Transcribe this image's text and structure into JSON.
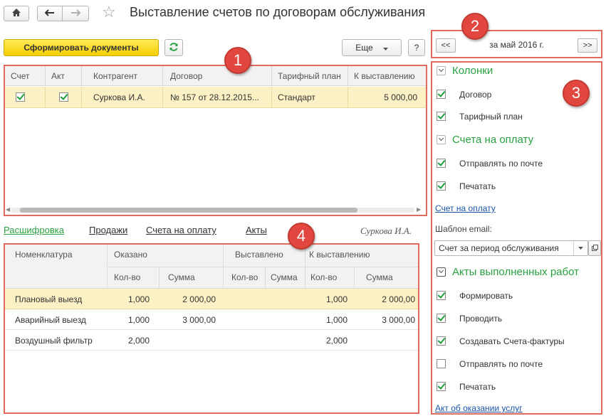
{
  "window": {
    "title": "Выставление счетов по договорам обслуживания"
  },
  "toolbar": {
    "generate_label": "Сформировать документы",
    "more_label": "Еще",
    "help_label": "?"
  },
  "period": {
    "prev_label": "<<",
    "label": "за май 2016 г.",
    "next_label": ">>"
  },
  "contracts_table": {
    "columns": [
      "Счет",
      "Акт",
      "Контрагент",
      "Договор",
      "Тарифный план",
      "К выставлению"
    ],
    "rows": [
      {
        "invoice": true,
        "act": true,
        "counterparty": "Суркова И.А.",
        "contract": "№ 157 от 28.12.2015...",
        "tariff": "Стандарт",
        "to_bill": "5 000,00"
      }
    ]
  },
  "tabs": {
    "items": [
      "Расшифровка",
      "Продажи",
      "Счета на оплату",
      "Акты"
    ],
    "active": "Расшифровка",
    "counterparty_note": "Суркова И.А."
  },
  "details_table": {
    "nomenclature_header": "Номенклатура",
    "group_headers": [
      "Оказано",
      "Выставлено",
      "К выставлению"
    ],
    "sub_headers": [
      "Кол-во",
      "Сумма",
      "Кол-во",
      "Сумма",
      "Кол-во",
      "Сумма"
    ],
    "rows": [
      {
        "name": "Плановый выезд",
        "done_qty": "1,000",
        "done_sum": "2 000,00",
        "billed_qty": "",
        "billed_sum": "",
        "to_bill_qty": "1,000",
        "to_bill_sum": "2 000,00"
      },
      {
        "name": "Аварийный выезд",
        "done_qty": "1,000",
        "done_sum": "3 000,00",
        "billed_qty": "",
        "billed_sum": "",
        "to_bill_qty": "1,000",
        "to_bill_sum": "3 000,00"
      },
      {
        "name": "Воздушный фильтр",
        "done_qty": "2,000",
        "done_sum": "",
        "billed_qty": "",
        "billed_sum": "",
        "to_bill_qty": "2,000",
        "to_bill_sum": ""
      }
    ]
  },
  "settings_panel": {
    "columns_title": "Колонки",
    "columns_options": [
      {
        "label": "Договор",
        "checked": true
      },
      {
        "label": "Тарифный план",
        "checked": true
      }
    ],
    "invoices_title": "Счета на оплату",
    "invoices_options": [
      {
        "label": "Отправлять по почте",
        "checked": true
      },
      {
        "label": "Печатать",
        "checked": true
      }
    ],
    "invoice_link": "Счет на оплату",
    "email_template_label": "Шаблон email:",
    "email_template_value": "Счет за период обслуживания",
    "acts_title": "Акты выполненных работ",
    "acts_options": [
      {
        "label": "Формировать",
        "checked": true
      },
      {
        "label": "Проводить",
        "checked": true
      },
      {
        "label": "Создавать Счета-фактуры",
        "checked": true
      },
      {
        "label": "Отправлять по почте",
        "checked": false
      },
      {
        "label": "Печатать",
        "checked": true
      }
    ],
    "act_link": "Акт об оказании услуг"
  },
  "badges": [
    "1",
    "2",
    "3",
    "4"
  ],
  "colors": {
    "accent_green": "#2ba043",
    "selected_row": "#fbf1c4",
    "primary_button": "#f5cf00",
    "annotation_red": "#e2473f",
    "link_blue": "#1a55a8"
  }
}
